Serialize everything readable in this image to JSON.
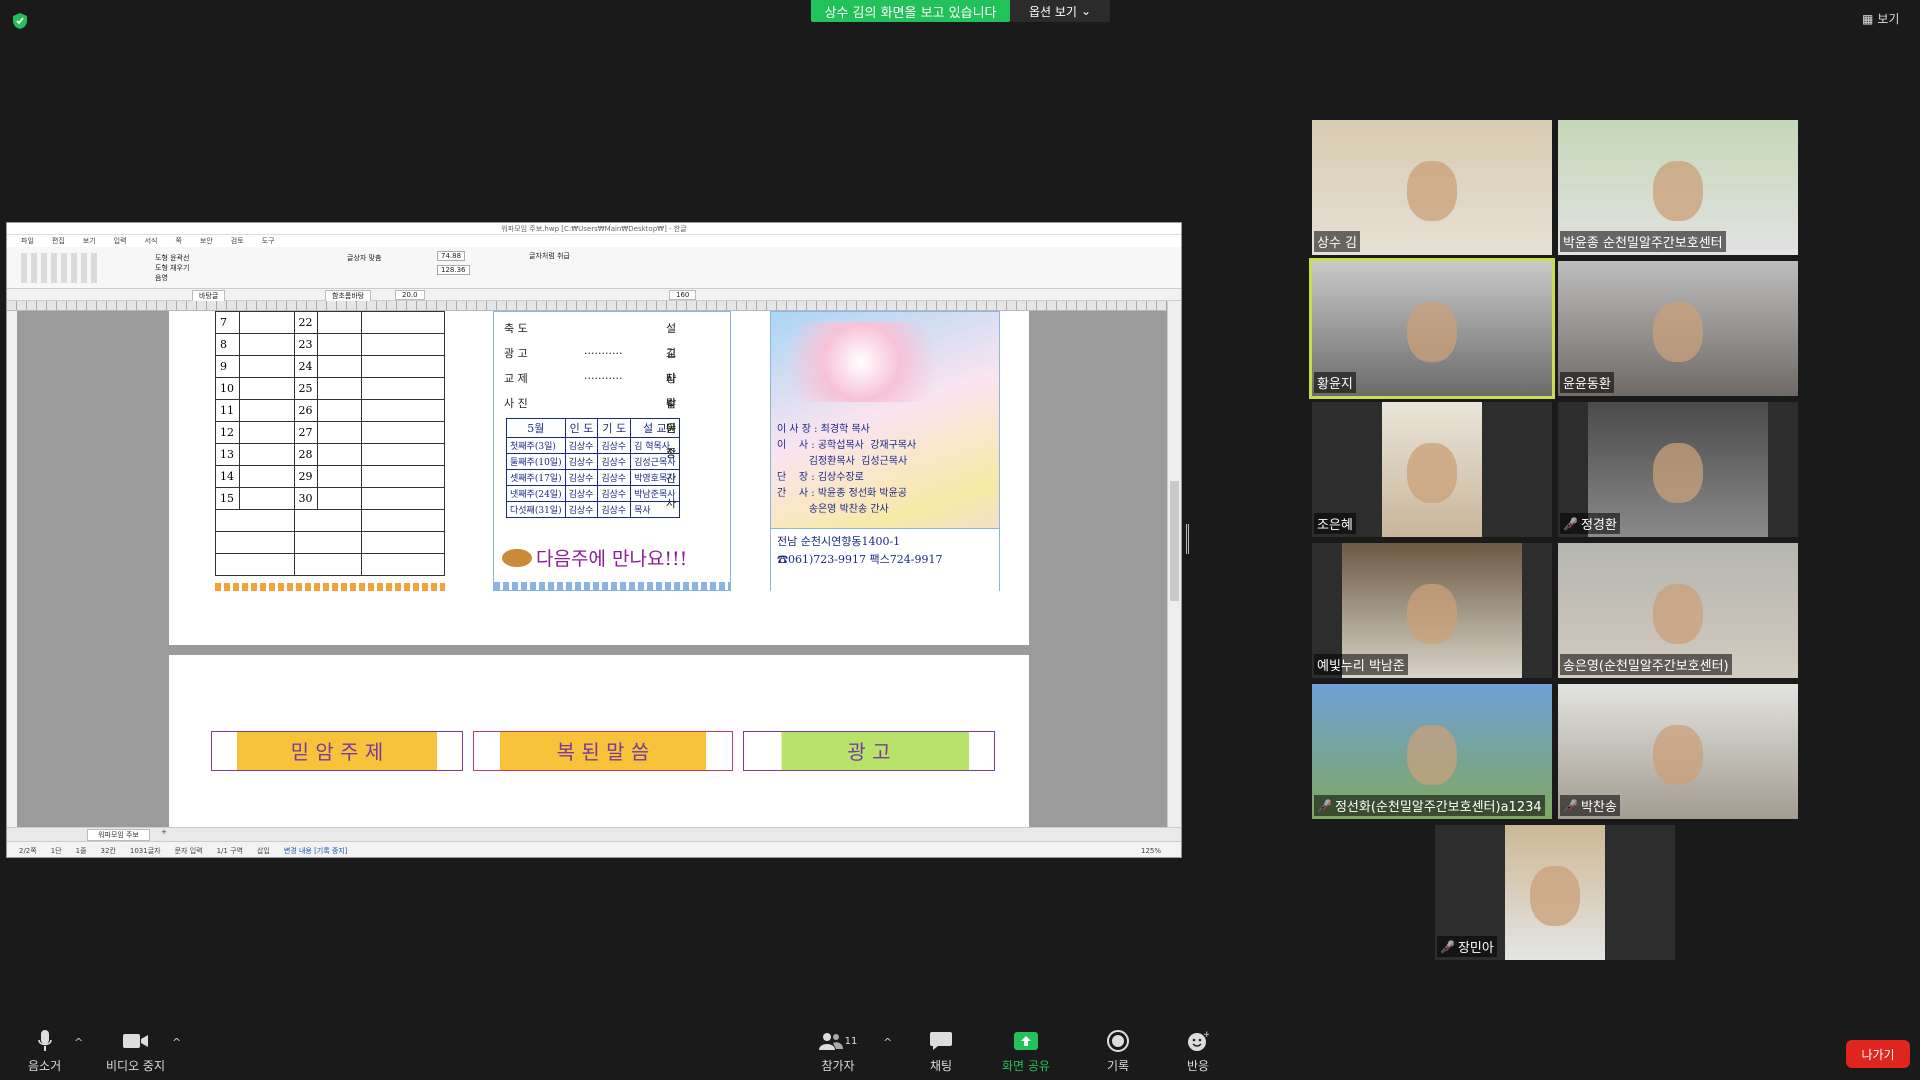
{
  "banner": {
    "sharing_text": "상수 김의 화면을 보고 있습니다",
    "view_options": "옵션 보기"
  },
  "view_button": "보기",
  "window": {
    "title": "워파모임 주보.hwp [C:₩Users₩Main₩Desktop₩] - 한글",
    "menu": [
      "파일",
      "편집",
      "보기",
      "입력",
      "서식",
      "쪽",
      "보안",
      "검토",
      "도구"
    ],
    "ribbon_labels": {
      "shape_fill": "도형 윤곽선",
      "shape_fill2": "도형 채우기",
      "shadow": "음영",
      "picture": "그림자 효과",
      "fontsize_w": "74.88",
      "fontsize_h": "128.36",
      "unit": "mm",
      "align": "글상자 맞춤",
      "wrap": "글자처럼 취급"
    },
    "format": {
      "style": "바탕글",
      "font": "함초롬바탕",
      "size": "20.0",
      "unit": "pt",
      "zoom": "160",
      "tab": "워파모임 주보"
    },
    "status": [
      "2/2쪽",
      "1단",
      "1줄",
      "32칸",
      "1031글자",
      "문자 입력",
      "1/1 구역",
      "삽입",
      "변경 내용 [기록 중지]",
      "125%"
    ]
  },
  "calendar": {
    "left": [
      "7",
      "8",
      "9",
      "10",
      "11",
      "12",
      "13",
      "14",
      "15"
    ],
    "right": [
      "22",
      "23",
      "24",
      "25",
      "26",
      "27",
      "28",
      "29",
      "30"
    ]
  },
  "worship": {
    "roles": [
      {
        "k": "축  도",
        "v": "설교자"
      },
      {
        "k": "광  고",
        "dots": "···········",
        "v": "김상수단장"
      },
      {
        "k": "교  제",
        "dots": "···········",
        "v": "다같이"
      },
      {
        "k": "사  진",
        "v": "박윤종간사"
      }
    ],
    "table_head": [
      "5월",
      "인 도",
      "기 도",
      "설 교"
    ],
    "table_rows": [
      [
        "첫째주(3일)",
        "김상수",
        "김상수",
        "김  혁목사"
      ],
      [
        "둘째주(10일)",
        "김상수",
        "김상수",
        "김성근목사"
      ],
      [
        "셋째주(17일)",
        "김상수",
        "김상수",
        "박영호목사"
      ],
      [
        "넷째주(24일)",
        "김상수",
        "김상수",
        "박남준목사"
      ],
      [
        "다섯째(31일)",
        "김상수",
        "김상수",
        "목사"
      ]
    ],
    "see_you": "다음주에 만나요!!!"
  },
  "org": {
    "lines": [
      "이 사 장 : 최경학 목사",
      "이    사 : 공학섭목사  강재구목사",
      "          김정환목사  김성근목사",
      "단    장 : 김상수장로",
      "간    사 : 박윤종 정선화 박윤공",
      "          송은영 박찬송 간사"
    ],
    "address": "전남 순천시연향동1400-1",
    "phone": "☎061)723-9917  팩스724-9917"
  },
  "page2": {
    "box1": "믿 암 주 제",
    "box2": "복 된 말 씀",
    "box3": "광    고"
  },
  "participants": [
    {
      "name": "상수 김",
      "muted": false
    },
    {
      "name": "박윤종 순천밀알주간보호센터",
      "muted": false
    },
    {
      "name": "황윤지",
      "muted": false,
      "active": true
    },
    {
      "name": "윤윤동환",
      "muted": false
    },
    {
      "name": "조은혜",
      "muted": false
    },
    {
      "name": "정경환",
      "muted": true
    },
    {
      "name": "예빛누리 박남준",
      "muted": false
    },
    {
      "name": "송은영(순천밀알주간보호센터)",
      "muted": false
    },
    {
      "name": "정선화(순천밀알주간보호센터)a1234",
      "muted": true
    },
    {
      "name": "박찬송",
      "muted": true
    },
    {
      "name": "장민아",
      "muted": true
    }
  ],
  "toolbar": {
    "mute": "음소거",
    "video": "비디오 중지",
    "participants": "참가자",
    "participants_count": "11",
    "chat": "채팅",
    "share": "화면 공유",
    "record": "기록",
    "reactions": "반응",
    "leave": "나가기"
  },
  "colors": {
    "share_green": "#23c15a",
    "leave_red": "#e0241e",
    "active_border": "#c8df4b"
  }
}
